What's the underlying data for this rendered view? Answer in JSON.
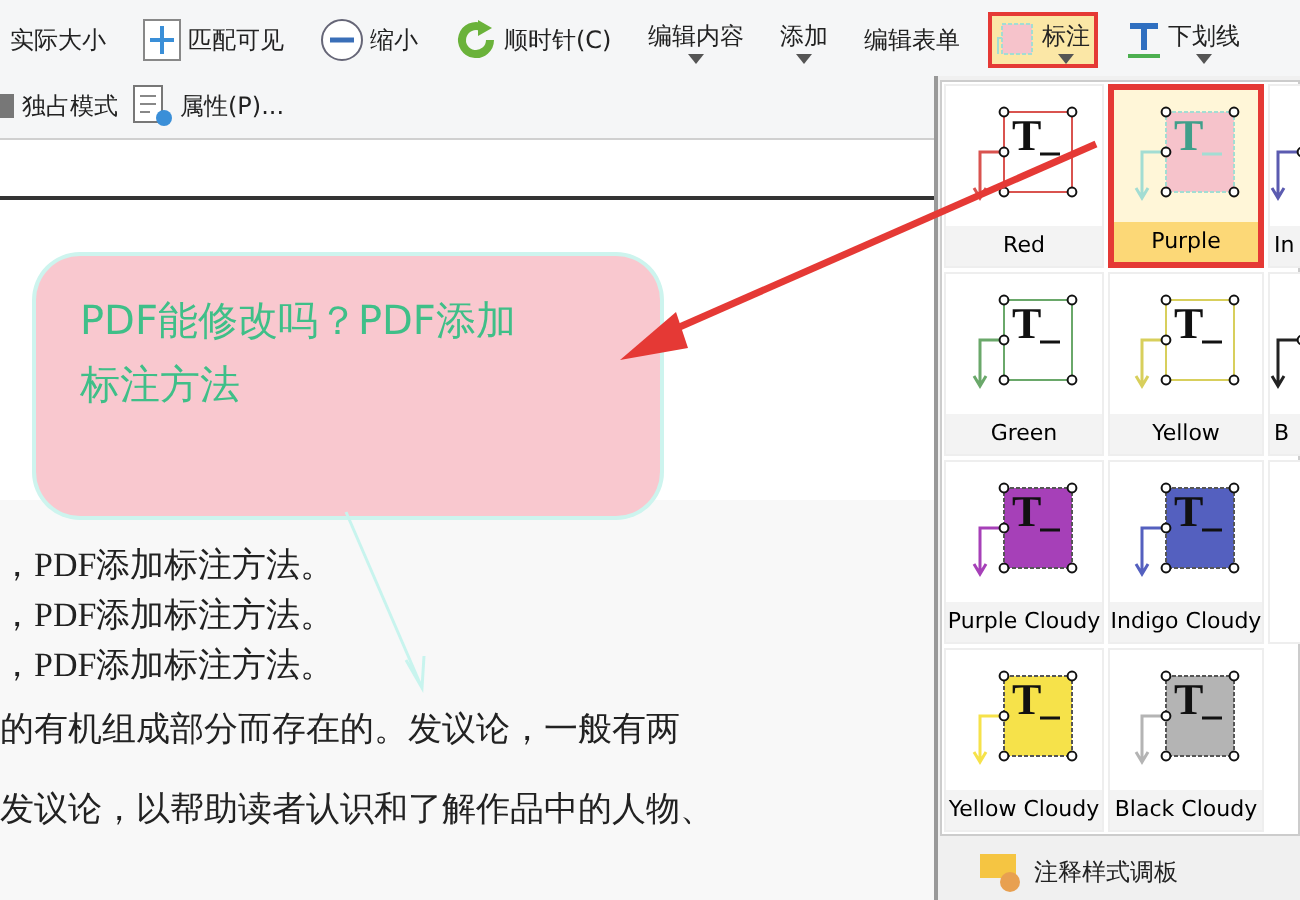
{
  "ribbon": {
    "row1": [
      {
        "label": "实际大小",
        "caret": false,
        "selected": false
      },
      {
        "label": "匹配可见",
        "caret": false,
        "selected": false
      },
      {
        "label": "缩小",
        "caret": false,
        "selected": false
      },
      {
        "label": "顺时针(C)",
        "caret": false,
        "selected": false
      },
      {
        "label": "编辑内容",
        "caret": true,
        "selected": false
      },
      {
        "label": "添加",
        "caret": true,
        "selected": false
      },
      {
        "label": "编辑表单",
        "caret": false,
        "selected": false
      },
      {
        "label": "标注",
        "caret": true,
        "selected": true
      },
      {
        "label": "下划线",
        "caret": true,
        "selected": false
      }
    ],
    "row2": [
      {
        "label": "独占模式"
      },
      {
        "label": "属性(P)..."
      }
    ]
  },
  "document": {
    "callout": "PDF能修改吗？PDF添加标注方法",
    "lines": [
      "，PDF添加标注方法。",
      "，PDF添加标注方法。",
      "，PDF添加标注方法。",
      "的有机组成部分而存在的。发议论，一般有两",
      "发议论，以帮助读者认识和了解作品中的人物、"
    ]
  },
  "gallery": {
    "items": [
      {
        "label": "Red",
        "kind": "plain",
        "icon_text": "T",
        "color": "#d9534f",
        "selected": false
      },
      {
        "label": "Purple",
        "kind": "current",
        "icon_text": "T",
        "color": "#a3ddd3",
        "selected": true
      },
      {
        "label": "In",
        "kind": "partial",
        "color": "#5b5bb0",
        "selected": false
      },
      {
        "label": "Green",
        "kind": "plain",
        "icon_text": "T",
        "color": "#6aa86a",
        "selected": false
      },
      {
        "label": "Yellow",
        "kind": "plain",
        "icon_text": "T",
        "color": "#d8cf5c",
        "selected": false
      },
      {
        "label": "B",
        "kind": "partial",
        "color": "#222222",
        "selected": false
      },
      {
        "label": "Purple Cloudy",
        "kind": "cloudy",
        "icon_text": "T",
        "color": "#a640b8",
        "selected": false
      },
      {
        "label": "Indigo Cloudy",
        "kind": "cloudy",
        "icon_text": "T",
        "color": "#5460bf",
        "selected": false
      },
      {
        "label": "Yellow Cloudy",
        "kind": "cloudy",
        "icon_text": "T",
        "color": "#f6e24a",
        "selected": false
      },
      {
        "label": "Black Cloudy",
        "kind": "cloudy",
        "icon_text": "T",
        "color": "#b4b4b4",
        "selected": false
      }
    ],
    "footer": "注释样式调板"
  }
}
